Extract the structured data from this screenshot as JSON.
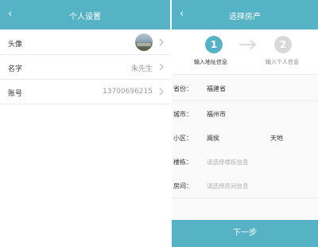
{
  "left": {
    "title": "个人设置",
    "rows": [
      {
        "label": "头像"
      },
      {
        "label": "名字",
        "value": "朱先生"
      },
      {
        "label": "账号",
        "value": "13700696215"
      }
    ]
  },
  "right": {
    "title": "选择房产",
    "steps": [
      {
        "number": "1",
        "label": "输入地址信息"
      },
      {
        "number": "2",
        "label": "输入个人信息"
      }
    ],
    "form": {
      "province": {
        "label": "省份：",
        "value": "福建省"
      },
      "city": {
        "label": "城市：",
        "value": "福州市"
      },
      "community": {
        "label": "小区：",
        "value": "闽侯",
        "suffix": "天地"
      },
      "building": {
        "label": "楼栋：",
        "placeholder": "请选择楼栋信息"
      },
      "room": {
        "label": "房间：",
        "placeholder": "请选择房间信息"
      }
    },
    "next_label": "下一步"
  },
  "colors": {
    "accent": "#56b3c5",
    "inactive_step": "#d9d9d9"
  }
}
